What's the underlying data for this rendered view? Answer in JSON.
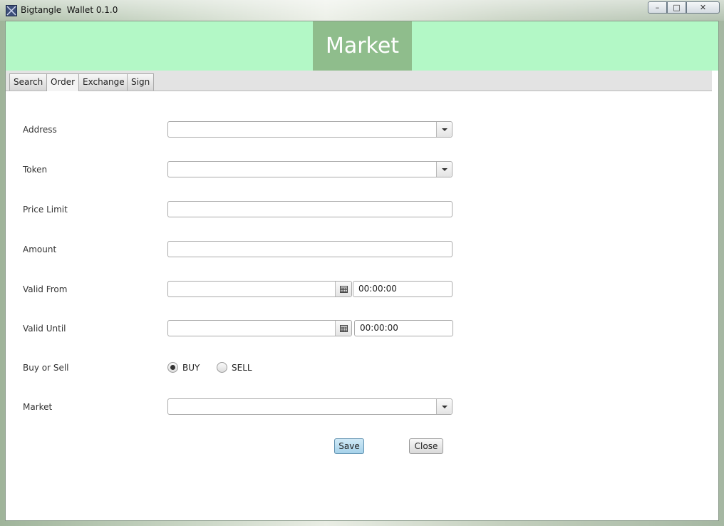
{
  "window": {
    "title": "Bigtangle  Wallet 0.1.0",
    "minimize": "–",
    "maximize": "□",
    "close": "✕"
  },
  "header": {
    "title": "Market"
  },
  "tabs": [
    {
      "label": "Search",
      "active": false
    },
    {
      "label": "Order",
      "active": true
    },
    {
      "label": "Exchange",
      "active": false
    },
    {
      "label": "Sign",
      "active": false
    }
  ],
  "form": {
    "address_label": "Address",
    "address_value": "",
    "token_label": "Token",
    "token_value": "",
    "price_limit_label": "Price Limit",
    "price_limit_value": "",
    "amount_label": "Amount",
    "amount_value": "",
    "valid_from_label": "Valid From",
    "valid_from_date": "",
    "valid_from_time": "00:00:00",
    "valid_until_label": "Valid Until",
    "valid_until_date": "",
    "valid_until_time": "00:00:00",
    "buy_sell_label": "Buy or Sell",
    "buy_label": "BUY",
    "sell_label": "SELL",
    "buy_sell_selected": "BUY",
    "market_label": "Market",
    "market_value": ""
  },
  "buttons": {
    "save": "Save",
    "close": "Close"
  },
  "icons": {
    "app": "bigtangle-logo-icon",
    "calendar": "calendar-icon",
    "dropdown": "chevron-down-icon"
  },
  "colors": {
    "header_bg": "#b3f8c6",
    "header_title_bg": "#8fbd8c",
    "save_button": "#a6d2ea"
  }
}
